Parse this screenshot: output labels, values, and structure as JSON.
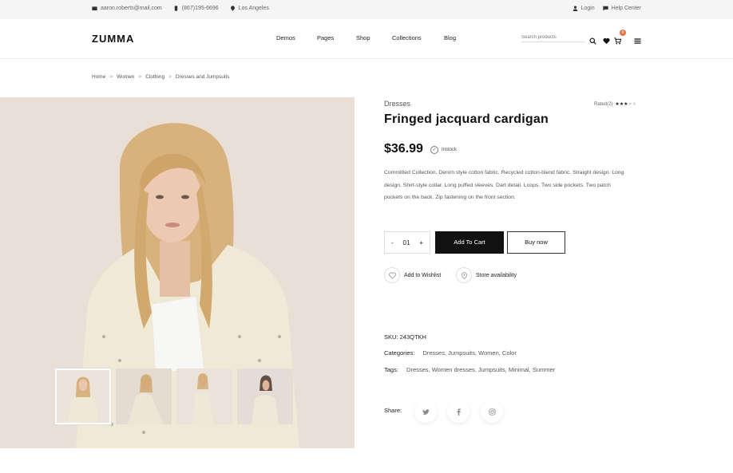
{
  "topbar": {
    "email": "aaron.roberts@mail.com",
    "phone": "(867)195-6696",
    "location": "Los Angeles",
    "login": "Login",
    "help": "Help Center"
  },
  "header": {
    "logo": "ZUMMA",
    "nav": [
      "Demos",
      "Pages",
      "Shop",
      "Collections",
      "Blog"
    ],
    "search_placeholder": "Search products",
    "cart_count": "0"
  },
  "breadcrumb": [
    "Home",
    "Women",
    "Clothing",
    "Dresses and Jumpsuits"
  ],
  "product": {
    "category": "Dresses",
    "rated_label": "Rated(2)",
    "rating": 3,
    "rating_max": 5,
    "title": "Fringed jacquard cardigan",
    "price": "$36.99",
    "stock": "Instock",
    "description": "Committed Collection. Denim style cotton fabric. Recycled cotton-blend fabric. Straight design. Long design. Shirt-style collar. Long puffed sleeves. Dart detail. Loops. Two side pockets. Two patch pockets on the back. Zip fastening on the front section.",
    "qty_minus": "-",
    "qty_value": "01",
    "qty_plus": "+",
    "add_to_cart": "Add To Cart",
    "buy_now": "Buy now",
    "wishlist": "Add to Wishlist",
    "store": "Store availability",
    "sku_label": "SKU:",
    "sku": "243QTKH",
    "categories_label": "Categories:",
    "categories": "Dresses, Jumpsuits, Women, Color",
    "tags_label": "Tags:",
    "tags": "Dresses, Women dresses, Jumpsuits, Minimal, Summer",
    "share_label": "Share:"
  },
  "icons": [
    "mail-icon",
    "phone-icon",
    "location-icon",
    "user-icon",
    "chat-icon",
    "search-icon",
    "heart-icon",
    "cart-icon",
    "menu-icon",
    "check-circle-icon",
    "twitter-icon",
    "facebook-icon",
    "instagram-icon"
  ],
  "colors": {
    "accent": "#e8724a",
    "primary_button": "#111111",
    "image_bg": "#eadfd6"
  }
}
